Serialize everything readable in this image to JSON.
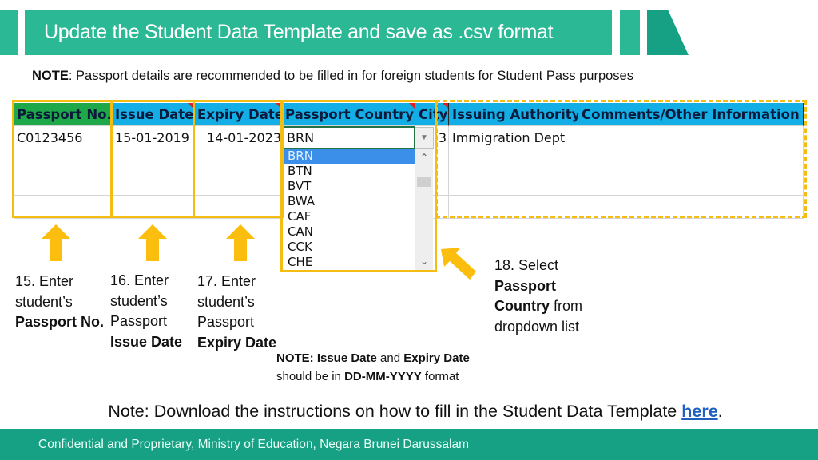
{
  "header": {
    "title": "Update the Student Data Template and save as .csv format",
    "accent_color": "#2bb895",
    "accent_dark": "#17a184"
  },
  "top_note": {
    "label": "NOTE",
    "text": ": Passport details are recommended to be filled in for foreign students for Student Pass purposes"
  },
  "sheet": {
    "columns": [
      {
        "label": "Passport No.",
        "color": "#1ea84a"
      },
      {
        "label": "Issue Date",
        "color": "#13aee6"
      },
      {
        "label": "Expiry Date",
        "color": "#13aee6"
      },
      {
        "label": "Passport Country",
        "color": "#13aee6"
      },
      {
        "label": "City",
        "color": "#13aee6"
      },
      {
        "label": "Issuing Authority",
        "color": "#13aee6"
      },
      {
        "label": "Comments/Other Information",
        "color": "#13aee6"
      }
    ],
    "rows": [
      [
        "C0123456",
        "15-01-2019",
        "14-01-2023",
        "BRN",
        "3",
        "Immigration Dept",
        ""
      ],
      [
        "",
        "",
        "",
        "",
        "",
        "",
        ""
      ],
      [
        "",
        "",
        "",
        "",
        "",
        "",
        ""
      ],
      [
        "",
        "",
        "",
        "",
        "",
        "",
        ""
      ]
    ],
    "highlight_color": "#f5bd12"
  },
  "dropdown": {
    "selected": "BRN",
    "options": [
      "BRN",
      "BTN",
      "BVT",
      "BWA",
      "CAF",
      "CAN",
      "CCK",
      "CHE"
    ],
    "up_icon": "^",
    "down_icon": "v",
    "arrow_icon": "▼"
  },
  "steps": {
    "s15": {
      "line1": "15. Enter",
      "line2": "student’s",
      "bold": "Passport No."
    },
    "s16": {
      "line1": "16. Enter",
      "line2": "student’s",
      "line3": "Passport",
      "bold": "Issue Date"
    },
    "s17": {
      "line1": "17. Enter",
      "line2": "student’s",
      "line3": "Passport",
      "bold": "Expiry Date"
    },
    "s18": {
      "line1": "18. Select",
      "bold1": "Passport",
      "bold2": "Country",
      "rest": " from",
      "line4": "dropdown list"
    }
  },
  "date_note": {
    "label": "NOTE: Issue Date",
    "and": " and ",
    "expiry": "Expiry Date",
    "line2_pre": "should be in ",
    "format": "DD-MM-YYYY",
    "line2_post": " format"
  },
  "download_note": {
    "text": "Note: Download the instructions on how to fill in the Student Data Template ",
    "link": "here",
    "end": "."
  },
  "footer": {
    "text": "Confidential and Proprietary, Ministry of Education, Negara Brunei Darussalam"
  }
}
